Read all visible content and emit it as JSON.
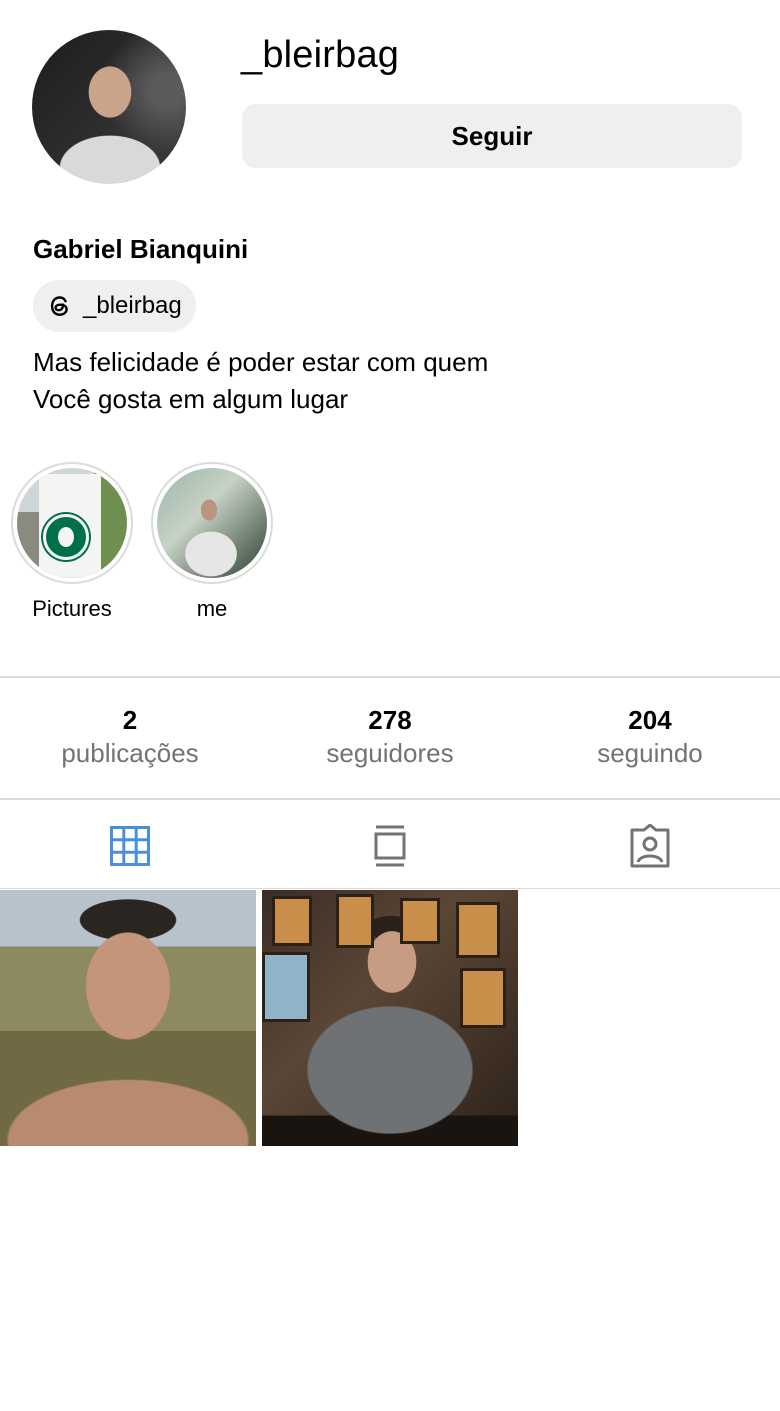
{
  "profile": {
    "username": "_bleirbag",
    "follow_label": "Seguir",
    "full_name": "Gabriel Bianquini",
    "threads_handle": "_bleirbag",
    "bio_lines": [
      "Mas felicidade é poder estar com quem",
      "Você gosta em algum lugar"
    ]
  },
  "highlights": [
    {
      "label": "Pictures"
    },
    {
      "label": "me"
    }
  ],
  "stats": [
    {
      "count": "2",
      "label": "publicações"
    },
    {
      "count": "278",
      "label": "seguidores"
    },
    {
      "count": "204",
      "label": "seguindo"
    }
  ],
  "tabs": [
    {
      "icon": "grid-icon",
      "active": true,
      "color": "#4a90d9"
    },
    {
      "icon": "reels-icon",
      "active": false,
      "color": "#737373"
    },
    {
      "icon": "tagged-icon",
      "active": false,
      "color": "#737373"
    }
  ],
  "colors": {
    "accent": "#4a90d9",
    "button_bg": "#efefef",
    "muted_text": "#737373",
    "divider": "#dbdbdb"
  }
}
